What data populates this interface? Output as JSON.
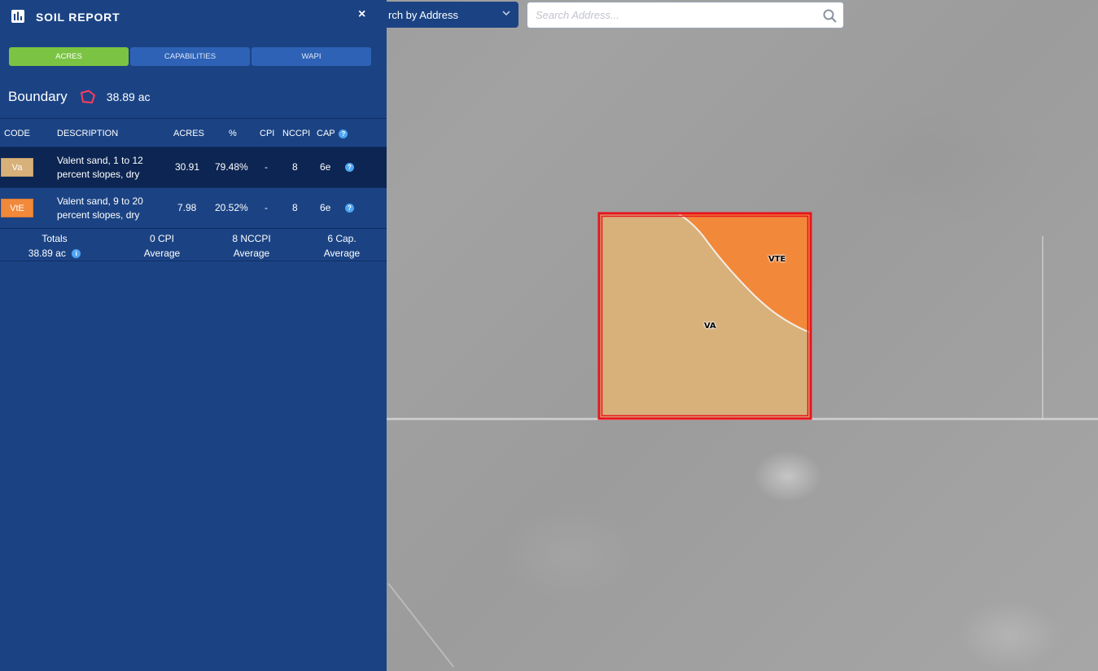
{
  "panel": {
    "title": "SOIL REPORT",
    "close_glyph": "×",
    "tabs": [
      "ACRES",
      "CAPABILITIES",
      "WAPI"
    ],
    "active_tab": "ACRES",
    "boundary": {
      "label": "Boundary",
      "acres": "38.89 ac"
    },
    "table": {
      "headers": {
        "code": "CODE",
        "description": "DESCRIPTION",
        "acres": "ACRES",
        "percent": "%",
        "cpi": "CPI",
        "nccpi": "NCCPI",
        "cap": "CAP"
      },
      "rows": [
        {
          "code": "Va",
          "color": "#d8b07a",
          "description": "Valent sand, 1 to 12 percent slopes, dry",
          "acres": "30.91",
          "percent": "79.48%",
          "cpi": "-",
          "nccpi": "8",
          "cap": "6e"
        },
        {
          "code": "VtE",
          "color": "#f2883a",
          "description": "Valent sand, 9 to 20 percent slopes, dry",
          "acres": "7.98",
          "percent": "20.52%",
          "cpi": "-",
          "nccpi": "8",
          "cap": "6e"
        }
      ],
      "totals": {
        "label": "Totals",
        "acres": "38.89 ac",
        "cpi_value": "0 CPI",
        "cpi_label": "Average",
        "nccpi_value": "8 NCCPI",
        "nccpi_label": "Average",
        "cap_value": "6 Cap.",
        "cap_label": "Average"
      }
    }
  },
  "search": {
    "type_label": "rch by Address",
    "placeholder": "Search Address..."
  },
  "map": {
    "parcel_outline_color": "#e8141e",
    "zones": [
      {
        "label": "VA",
        "color": "#d8b07a"
      },
      {
        "label": "VTE",
        "color": "#f2883a"
      }
    ]
  },
  "colors": {
    "panel_bg": "#1b4384",
    "tab_active": "#7bc343",
    "tab_inactive": "#2d62b6",
    "selected_row": "#0c2552",
    "help_icon": "#4ea5f3"
  },
  "icons": [
    "chart-icon",
    "close-icon",
    "boundary-polygon-icon",
    "help-icon",
    "chevron-down-icon",
    "search-icon"
  ]
}
